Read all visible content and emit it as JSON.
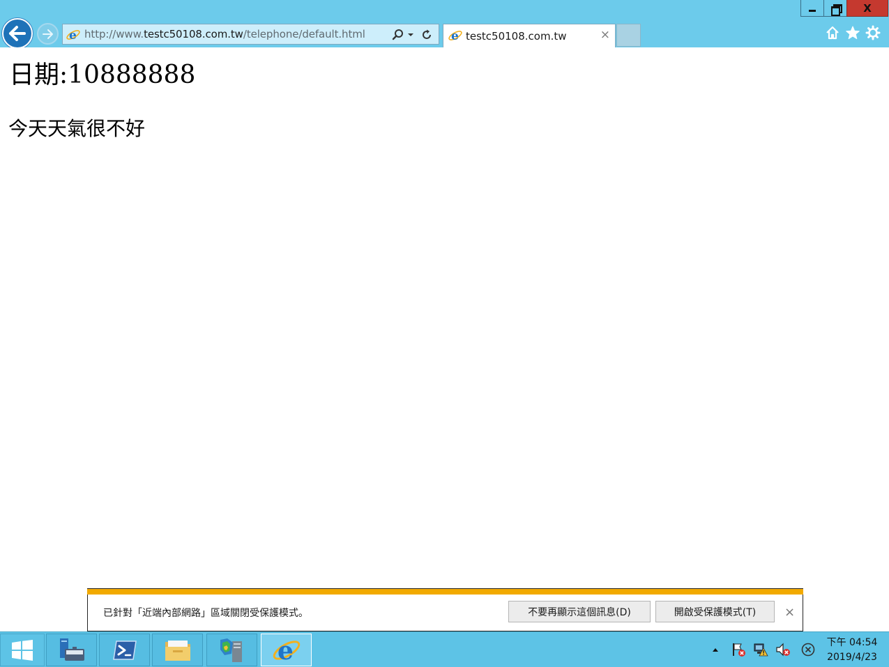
{
  "browser": {
    "address": {
      "prefix": "http://www.",
      "domain": "testc50108.com.tw",
      "path": "/telephone/default.html"
    },
    "tab": {
      "title": "testc50108.com.tw",
      "close": "×"
    },
    "window": {
      "close_label": "X"
    },
    "icons": [
      "back-arrow-icon",
      "forward-arrow-icon",
      "ie-icon",
      "search-icon",
      "refresh-icon",
      "home-icon",
      "favorites-star-icon",
      "gear-icon"
    ]
  },
  "page": {
    "heading": "日期:10888888",
    "paragraph": "今天天氣很不好"
  },
  "notification": {
    "message": "已針對「近端內部網路」區域關閉受保護模式。",
    "dont_show_label": "不要再顯示這個訊息(D)",
    "enable_label": "開啟受保護模式(T)",
    "close": "×"
  },
  "taskbar": {
    "items": [
      "windows-start",
      "server-manager",
      "powershell",
      "file-explorer",
      "admin-tools",
      "internet-explorer"
    ],
    "clock": {
      "time": "下午 04:54",
      "date": "2019/4/23"
    }
  },
  "colors": {
    "chrome": "#6ccbeb",
    "taskbar": "#5dc3e6",
    "notification_stripe": "#f2aa00",
    "back_button": "#1e72b8",
    "close_button": "#c5392f"
  }
}
